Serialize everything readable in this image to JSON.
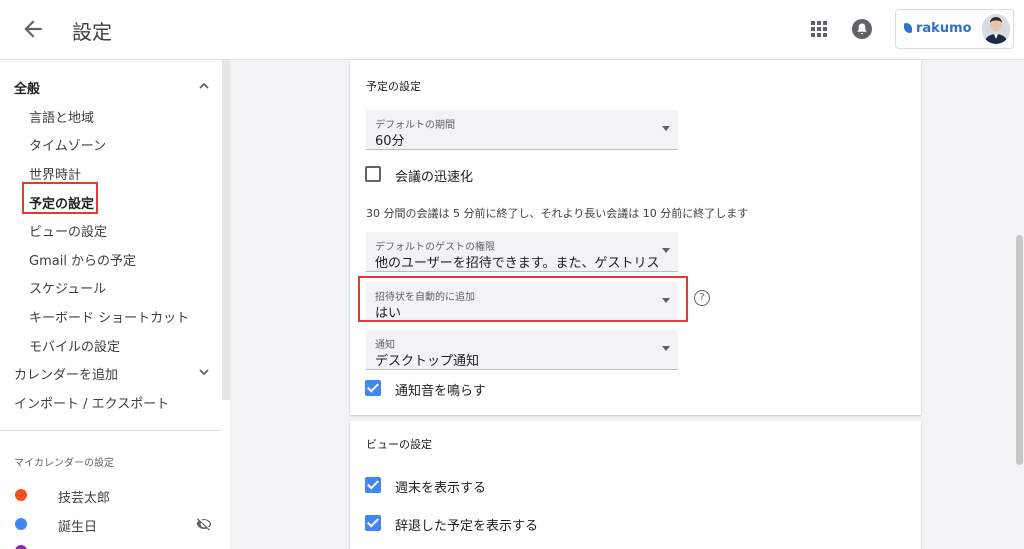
{
  "header": {
    "title": "設定",
    "brand": "rakumo"
  },
  "sidebar": {
    "general": "全般",
    "items": [
      "言語と地域",
      "タイムゾーン",
      "世界時計",
      "予定の設定",
      "ビューの設定",
      "Gmail からの予定",
      "スケジュール",
      "キーボード ショートカット",
      "モバイルの設定"
    ],
    "add_calendar": "カレンダーを追加",
    "import_export": "インポート / エクスポート",
    "my_calendars_label": "マイカレンダーの設定",
    "calendars": [
      {
        "name": "技芸太郎",
        "color": "#f4511e"
      },
      {
        "name": "誕生日",
        "color": "#4285f4"
      }
    ]
  },
  "event_settings": {
    "title": "予定の設定",
    "default_duration": {
      "label": "デフォルトの期間",
      "value": "60分"
    },
    "speedy_meetings": "会議の迅速化",
    "speedy_note": "30 分間の会議は 5 分前に終了し、それより長い会議は 10 分前に終了します",
    "guest_permissions": {
      "label": "デフォルトのゲストの権限",
      "value": "他のユーザーを招待できます。また、ゲストリス…"
    },
    "auto_add_invites": {
      "label": "招待状を自動的に追加",
      "value": "はい"
    },
    "notifications": {
      "label": "通知",
      "value": "デスクトップ通知"
    },
    "play_sound": "通知音を鳴らす"
  },
  "view_settings": {
    "title": "ビューの設定",
    "show_weekends": "週末を表示する",
    "show_declined": "辞退した予定を表示する"
  },
  "colors": {
    "accent": "#4285f4",
    "highlight": "#e53935"
  }
}
